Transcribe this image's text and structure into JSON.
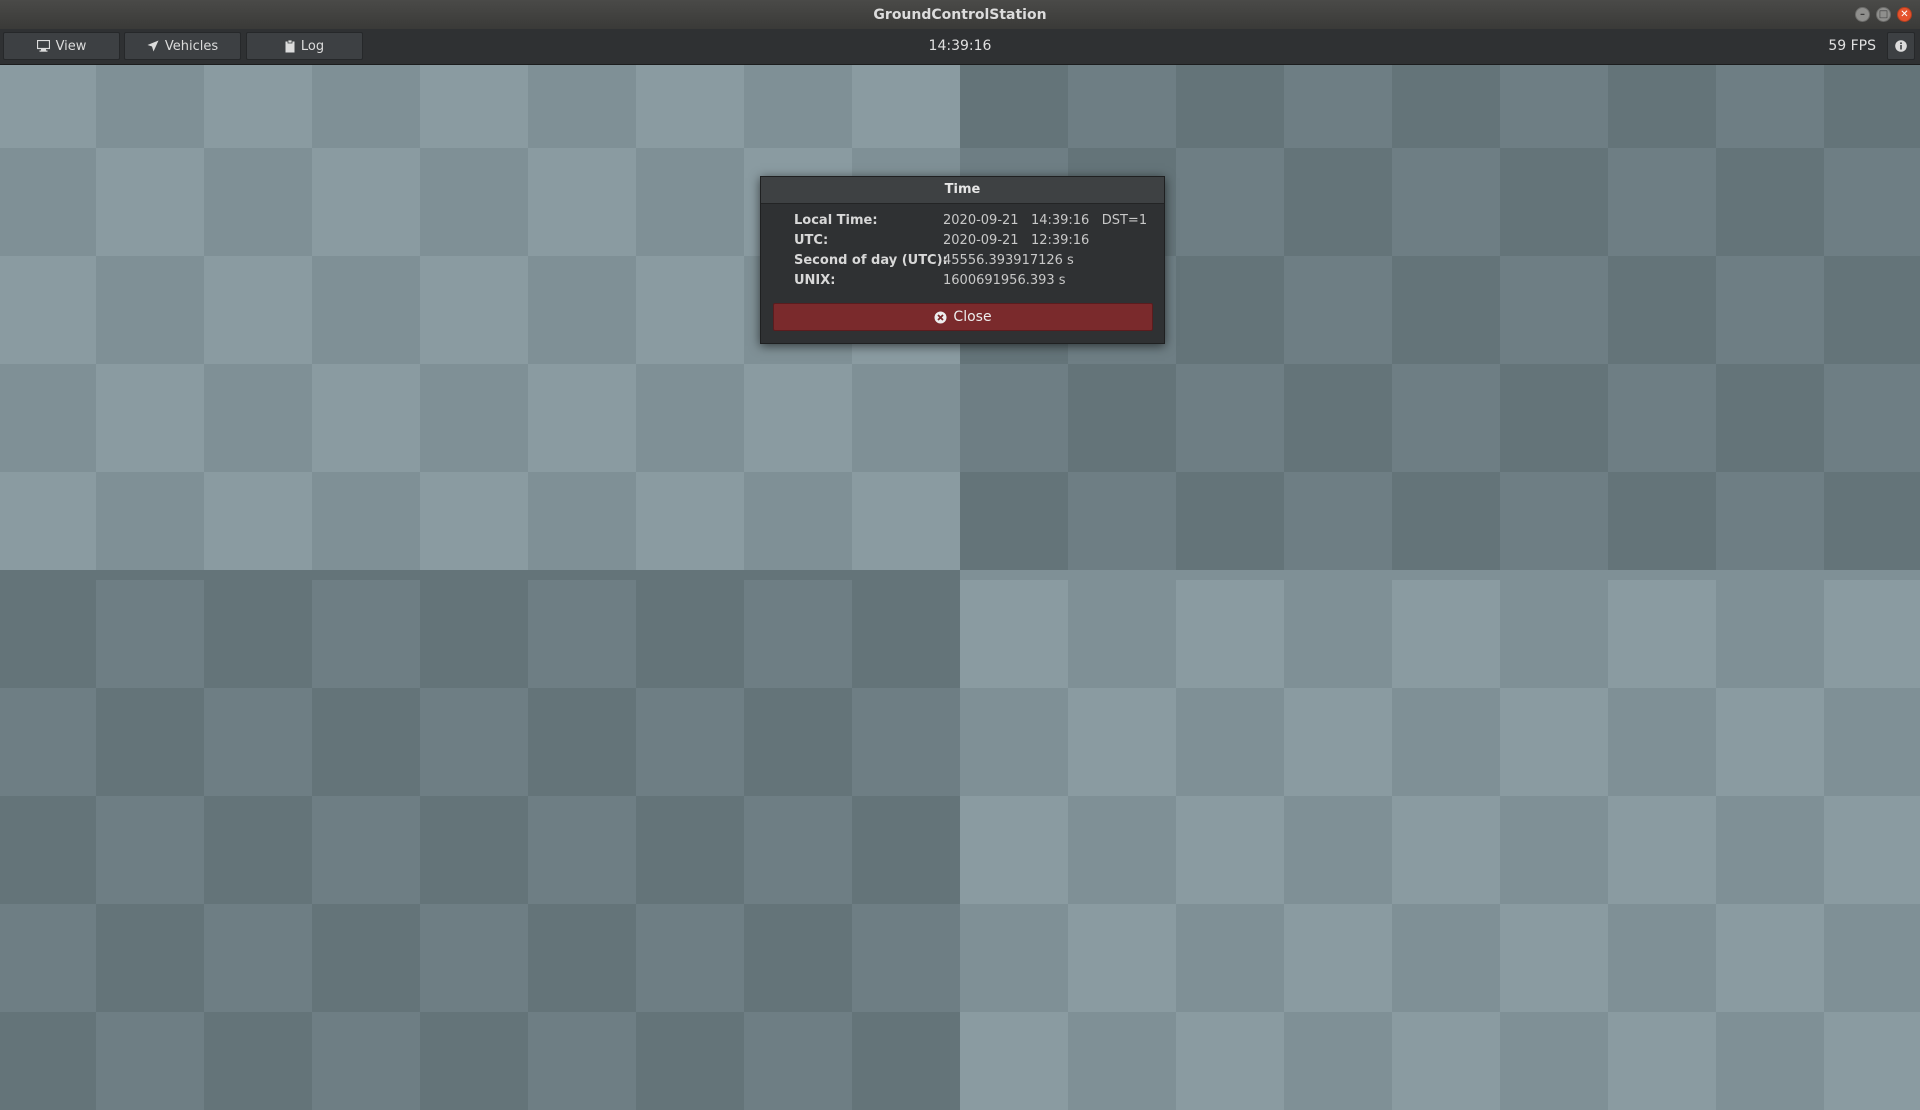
{
  "window": {
    "title": "GroundControlStation",
    "controls": [
      "minimize-icon",
      "maximize-icon",
      "close-icon"
    ]
  },
  "toolbar": {
    "view_label": "View",
    "view_icon": "monitor-icon",
    "vehicles_label": "Vehicles",
    "vehicles_icon": "paper-plane-icon",
    "log_label": "Log",
    "log_icon": "clipboard-icon",
    "clock": "14:39:16",
    "fps": "59 FPS",
    "info_icon": "info-icon"
  },
  "dialog": {
    "title": "Time",
    "rows": [
      {
        "label": "Local Time:",
        "value": "2020-09-21   14:39:16   DST=1"
      },
      {
        "label": "UTC:",
        "value": "2020-09-21   12:39:16"
      },
      {
        "label": "Second of day (UTC):",
        "value": "45556.393917126 s"
      },
      {
        "label": "UNIX:",
        "value": "1600691956.393 s"
      }
    ],
    "close_label": "Close",
    "close_icon": "circle-x-icon"
  },
  "colors": {
    "light_a": "#8a9ba1",
    "light_b": "#7f9096",
    "dark_a": "#6e7e84",
    "dark_b": "#647479",
    "close_button": "#7a2a2c",
    "window_close": "#e5532d"
  }
}
